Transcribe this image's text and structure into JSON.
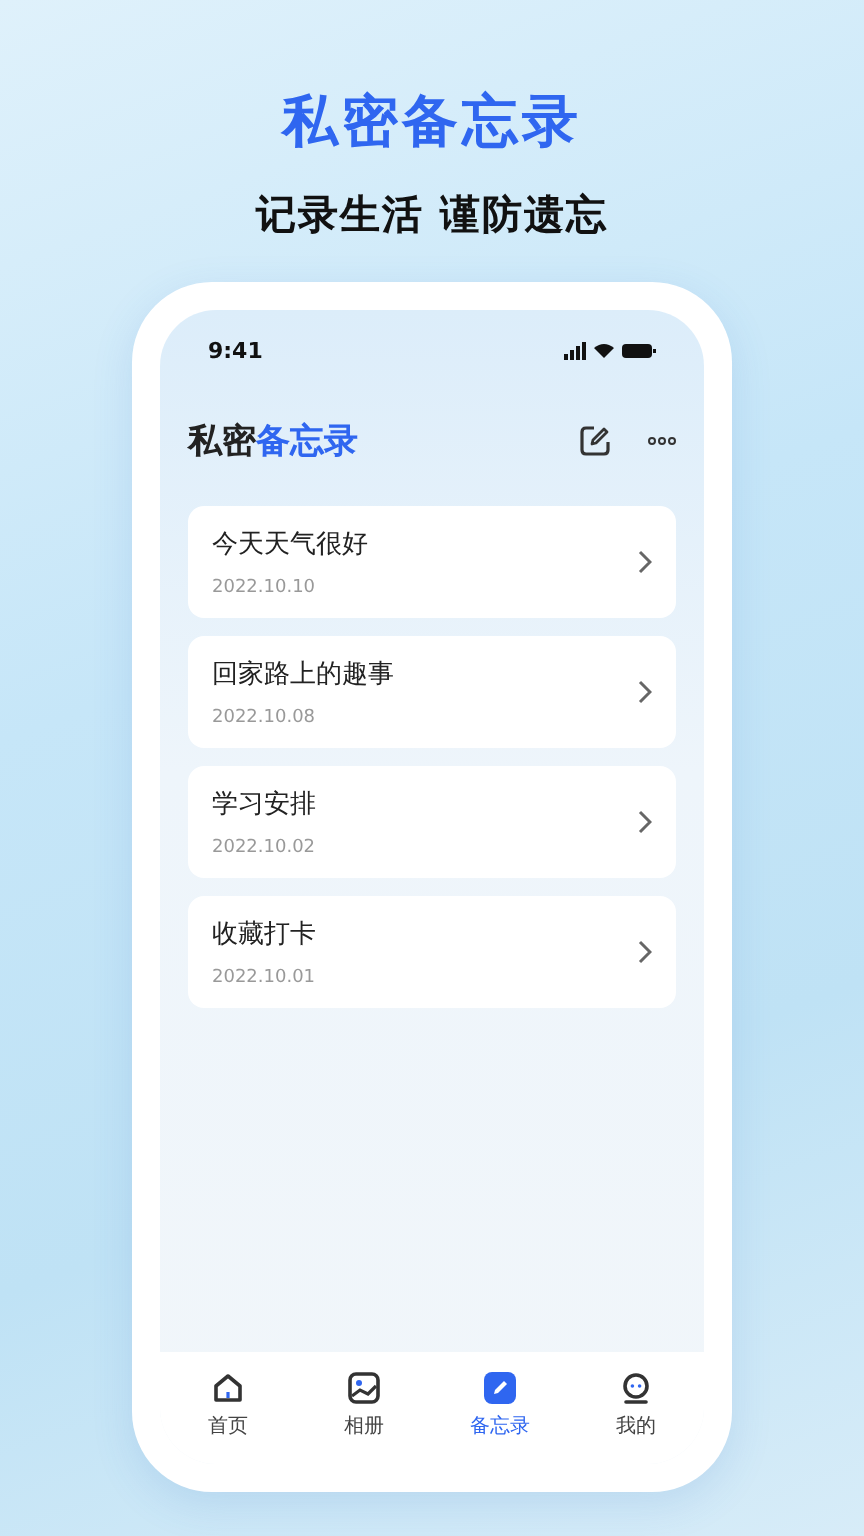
{
  "promo": {
    "headline": "私密备忘录",
    "tagline": "记录生活 谨防遗忘"
  },
  "status_bar": {
    "time": "9:41"
  },
  "header": {
    "title_dark": "私密",
    "title_accent": "备忘录"
  },
  "notes": [
    {
      "title": "今天天气很好",
      "date": "2022.10.10"
    },
    {
      "title": "回家路上的趣事",
      "date": "2022.10.08"
    },
    {
      "title": "学习安排",
      "date": "2022.10.02"
    },
    {
      "title": "收藏打卡",
      "date": "2022.10.01"
    }
  ],
  "tabs": [
    {
      "label": "首页",
      "selected": false
    },
    {
      "label": "相册",
      "selected": false
    },
    {
      "label": "备忘录",
      "selected": true
    },
    {
      "label": "我的",
      "selected": false
    }
  ]
}
